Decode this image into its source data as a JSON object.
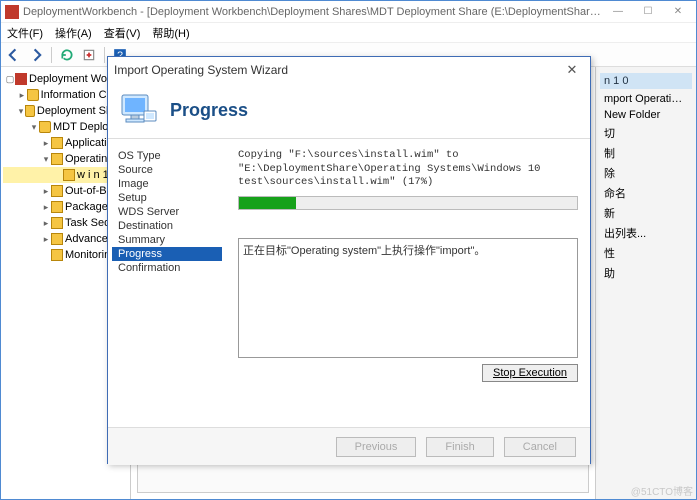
{
  "window": {
    "title": "DeploymentWorkbench - [Deployment Workbench\\Deployment Shares\\MDT Deployment Share (E:\\DeploymentShare)\\Operating Systems\\w i n...",
    "min": "—",
    "max": "☐",
    "close": "✕"
  },
  "menu": {
    "file": "文件(F)",
    "action": "操作(A)",
    "view": "查看(V)",
    "help": "帮助(H)"
  },
  "tree": {
    "root": "Deployment Workb",
    "info": "Information Cente",
    "shares": "Deployment Share",
    "mdt": "MDT Deploym",
    "apps": "Application",
    "os": "Operating S",
    "win1": "w i n 1",
    "oob": "Out-of-Box",
    "pkgs": "Packages",
    "tasks": "Task Seque",
    "adv": "Advanced C",
    "mon": "Monitoring"
  },
  "actions": {
    "head1": "n 1 0",
    "items": [
      "mport Operating Sy...",
      "New Folder",
      "切",
      "制",
      "除",
      "命名",
      "新",
      "出列表...",
      "性",
      "助"
    ]
  },
  "dialog": {
    "title": "Import Operating System Wizard",
    "heading": "Progress",
    "steps": [
      "OS Type",
      "Source",
      "Image",
      "Setup",
      "WDS Server",
      "Destination",
      "Summary",
      "Progress",
      "Confirmation"
    ],
    "current_step": 7,
    "copy_text": "Copying \"F:\\sources\\install.wim\" to \"E:\\DeploymentShare\\Operating Systems\\Windows 10 test\\sources\\install.wim\" (17%)",
    "progress_pct": 17,
    "log_line": "正在目标\"Operating system\"上执行操作\"import\"。",
    "stop": "Stop Execution",
    "prev": "Previous",
    "next": "Finish",
    "cancel": "Cancel"
  },
  "watermark": "@51CTO博客"
}
